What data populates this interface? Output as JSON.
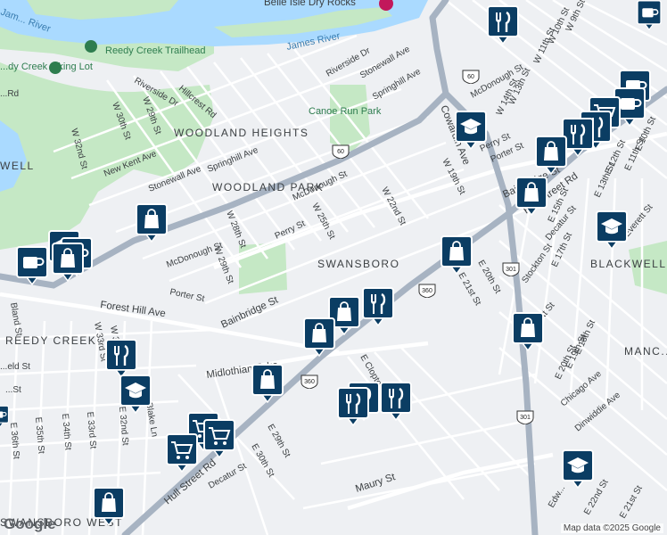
{
  "map": {
    "place_labels": {
      "belle_isle": "Belle Isle Dry Rocks",
      "james_river": "James River",
      "river_nw": "Jam... River",
      "reedy_creek_trailhead": "Reedy Creek Trailhead",
      "reedy_parking": "...dy Creek ...king Lot",
      "canoe_run_park": "Canoe Run Park",
      "woodland_heights": "WOODLAND HEIGHTS",
      "woodland_park": "WOODLAND PARK",
      "swansboro": "SWANSBORO",
      "reedy_creek": "REEDY CREEK",
      "blackwell": "BLACKWELL",
      "manchester": "MANC...",
      "swansboro_west": "SWANSBORO WEST",
      "well_w": "WELL"
    },
    "street_labels": {
      "riverside_dr_1": "Riverside Dr",
      "riverside_dr_2": "Riverside Dr",
      "hillcrest": "Hillcrest Rd",
      "w30": "W 30th St",
      "w29": "W 29th St",
      "w32": "W 32nd St",
      "new_kent": "New Kent Ave",
      "stonewall": "Stonewall Ave",
      "stonewall2": "Stonewall Ave",
      "springhill": "Springhill Ave",
      "springhill2": "Springhill Ave",
      "mcdonough": "McDonough St",
      "mcdonough2": "McDonough St",
      "mcdonough3": "McDonough St",
      "w28": "W 28th St",
      "w29b": "W 29th St",
      "w25": "W 25th St",
      "w22": "W 22nd St",
      "w19": "W 19th St",
      "perry": "Perry St",
      "perry2": "Perry St",
      "porter": "Porter St",
      "porter2": "Porter St",
      "bainbridge": "Bainbridge St",
      "bainbridge2": "Bainbridge St",
      "forest_hill": "Forest Hill Ave",
      "midlothian": "Midlothian Tpke",
      "hull_st": "Hull Street Rd",
      "hull_st2": "Hull Street Rd",
      "cowardin": "Cowardin Ave",
      "decatur": "Decatur St",
      "decatur2": "Decatur St",
      "stockton": "Stockton St",
      "e20": "E 20th St",
      "e21": "E 21st St",
      "e17": "E 17th St",
      "e18": "E 18th St",
      "e19": "E 19th St",
      "e20b": "E 20th St",
      "e15": "E 15th St",
      "e13": "E 13th St",
      "e12": "E 12th St",
      "e11": "E 11th St",
      "e10": "E 10th St",
      "w9": "W 9th St",
      "w10": "W 10th St",
      "w11": "W 11th St",
      "w13": "W 13th St",
      "w14": "W 14th St",
      "everett": "Everett St",
      "everett2": "Everett St",
      "chicago": "Chicago Ave",
      "dinwiddie": "Dinwiddie Ave",
      "maury": "Maury St",
      "e_clopton": "E Clopton St",
      "e29": "E 29th St",
      "e30": "E 30th St",
      "e33": "E 33rd St",
      "e34": "E 34th St",
      "e35": "E 35th St",
      "e36": "E 36th St",
      "e32": "E 32nd St",
      "w33": "W 33rd St",
      "w31": "W 31st St",
      "blake": "Blake Ln",
      "bland": "Bland St",
      "w_rd": "...Rd",
      "w_eld": "...eld St",
      "w_st": "...St",
      "edwards": "Edw...",
      "e22": "E 22nd St",
      "e21b": "E 21st St",
      "e6th": "E 6th..."
    },
    "shields": {
      "us60_a": "60",
      "us60_b": "60",
      "us360_a": "360",
      "us360_b": "360",
      "us301_a": "301",
      "us301_b": "301"
    },
    "markers": [
      {
        "type": "restaurant",
        "icon": "fork-knife-icon"
      },
      {
        "type": "shopping",
        "icon": "shopping-bag-icon"
      },
      {
        "type": "school",
        "icon": "graduation-cap-icon"
      },
      {
        "type": "cafe",
        "icon": "coffee-cup-icon"
      },
      {
        "type": "grocery",
        "icon": "shopping-cart-icon"
      }
    ],
    "colors": {
      "marker_fill": "#0b3d63",
      "park": "#c5e8c5",
      "water": "#aadaff",
      "highway": "#a7b3c2"
    }
  },
  "attribution": "Map data ©2025 Google",
  "logo": "Google"
}
